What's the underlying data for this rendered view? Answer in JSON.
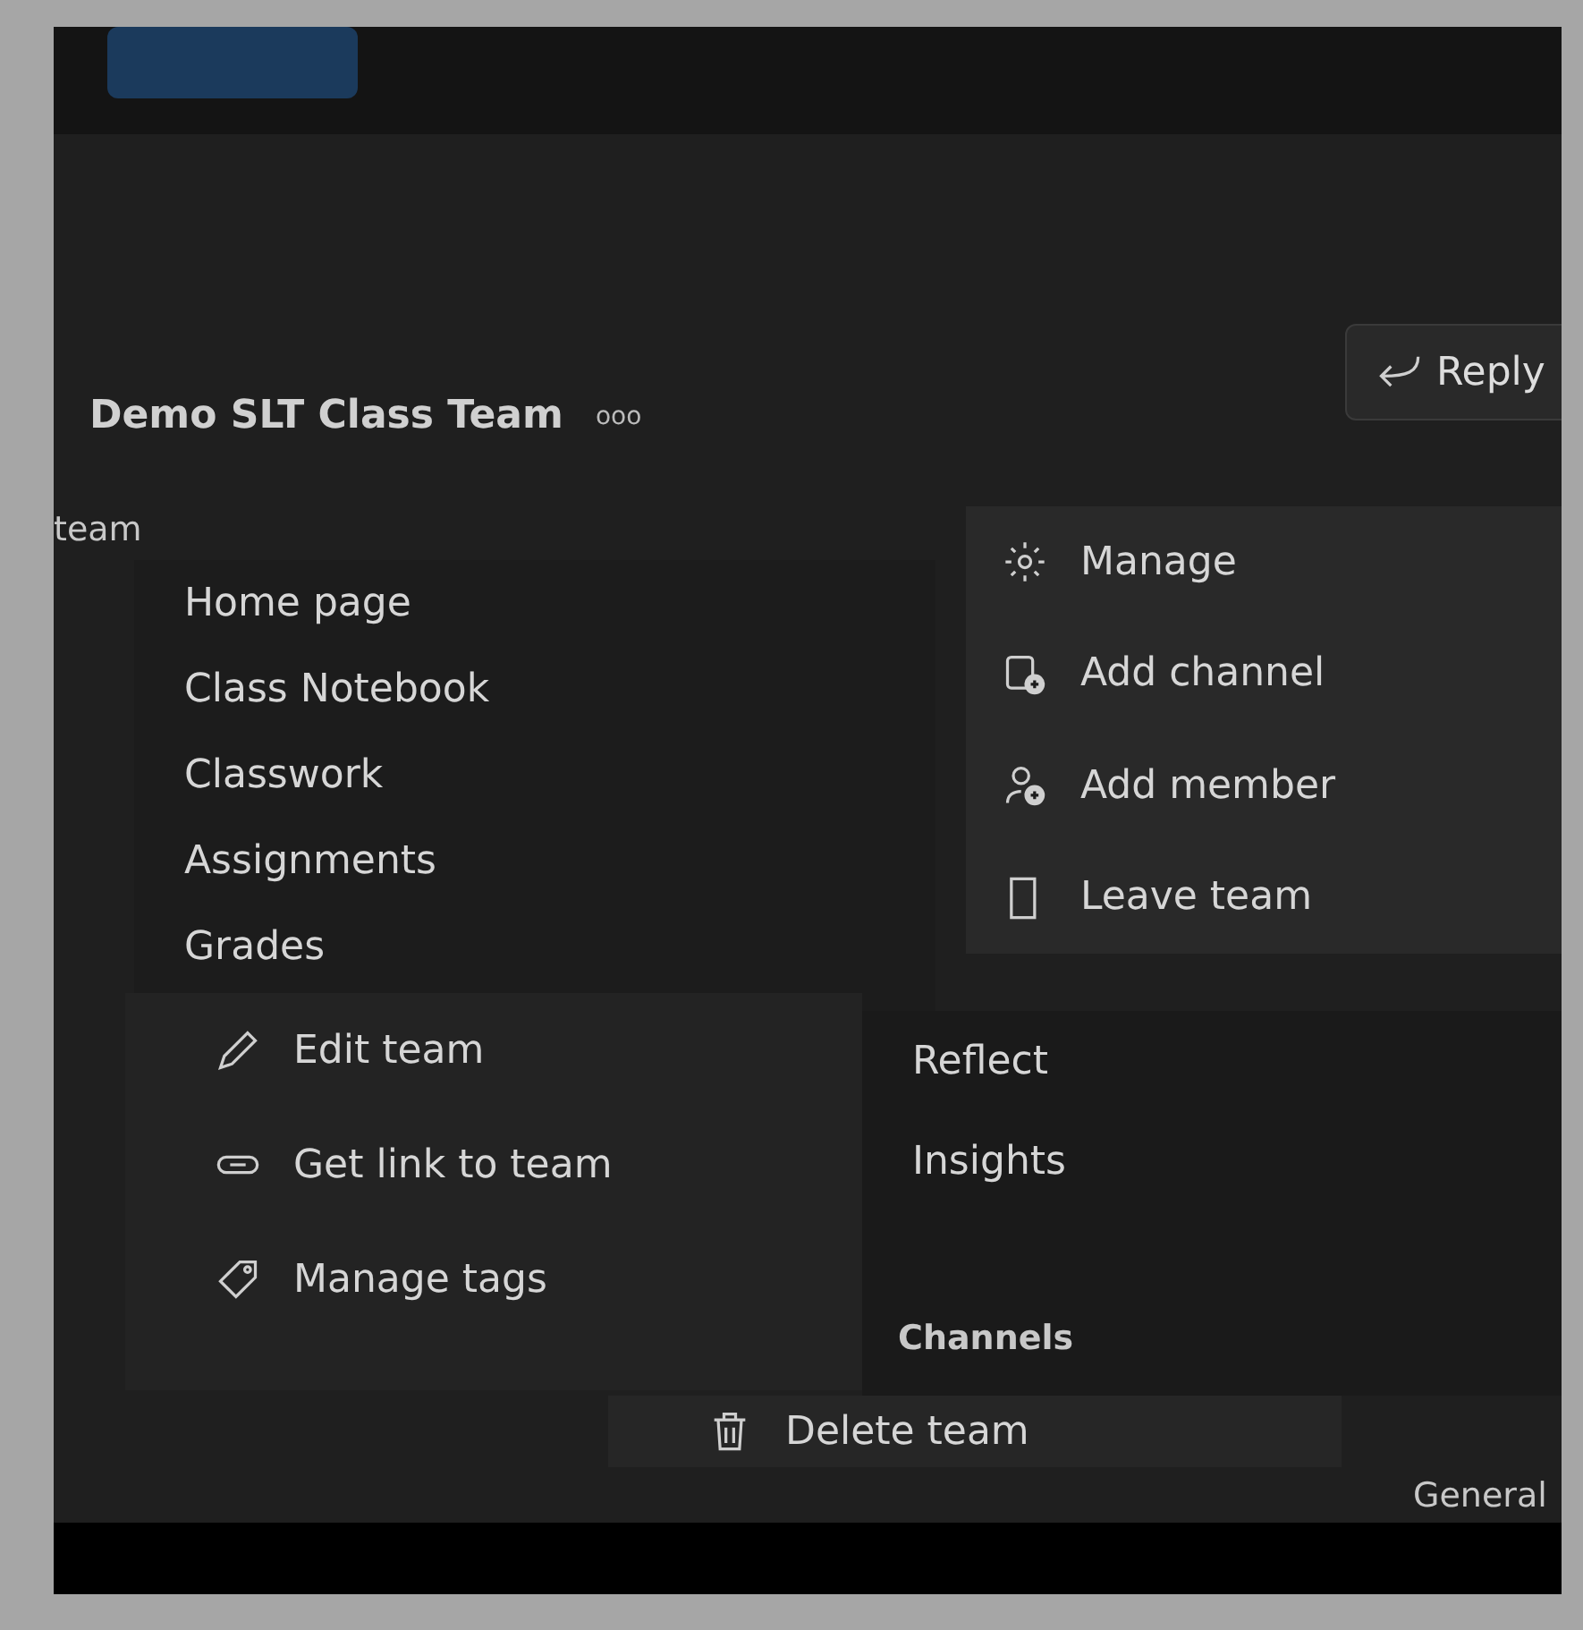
{
  "header": {
    "team_title": "Demo SLT Class Team",
    "more": "ooo",
    "reply_button": "Reply",
    "partial_label": "team"
  },
  "tabs_menu": {
    "items": [
      {
        "label": "Home page"
      },
      {
        "label": "Class Notebook"
      },
      {
        "label": "Classwork"
      },
      {
        "label": "Assignments"
      },
      {
        "label": "Grades"
      }
    ]
  },
  "team_menu": {
    "items": [
      {
        "label": "Manage",
        "kind": "gear"
      },
      {
        "label": "Add channel",
        "kind": "channel"
      },
      {
        "label": "Add member",
        "kind": "member"
      },
      {
        "label": "Leave team",
        "kind": "leave"
      }
    ]
  },
  "edit_menu": {
    "items": [
      {
        "label": "Edit team",
        "kind": "pencil"
      },
      {
        "label": "Get link to team",
        "kind": "link"
      },
      {
        "label": "Manage tags",
        "kind": "tag"
      }
    ]
  },
  "apps_menu": {
    "items": [
      {
        "label": "Reflect"
      },
      {
        "label": "Insights"
      }
    ],
    "section": "Channels"
  },
  "delete_item": {
    "label": "Delete team",
    "kind": "trash"
  },
  "channel_label": "General"
}
